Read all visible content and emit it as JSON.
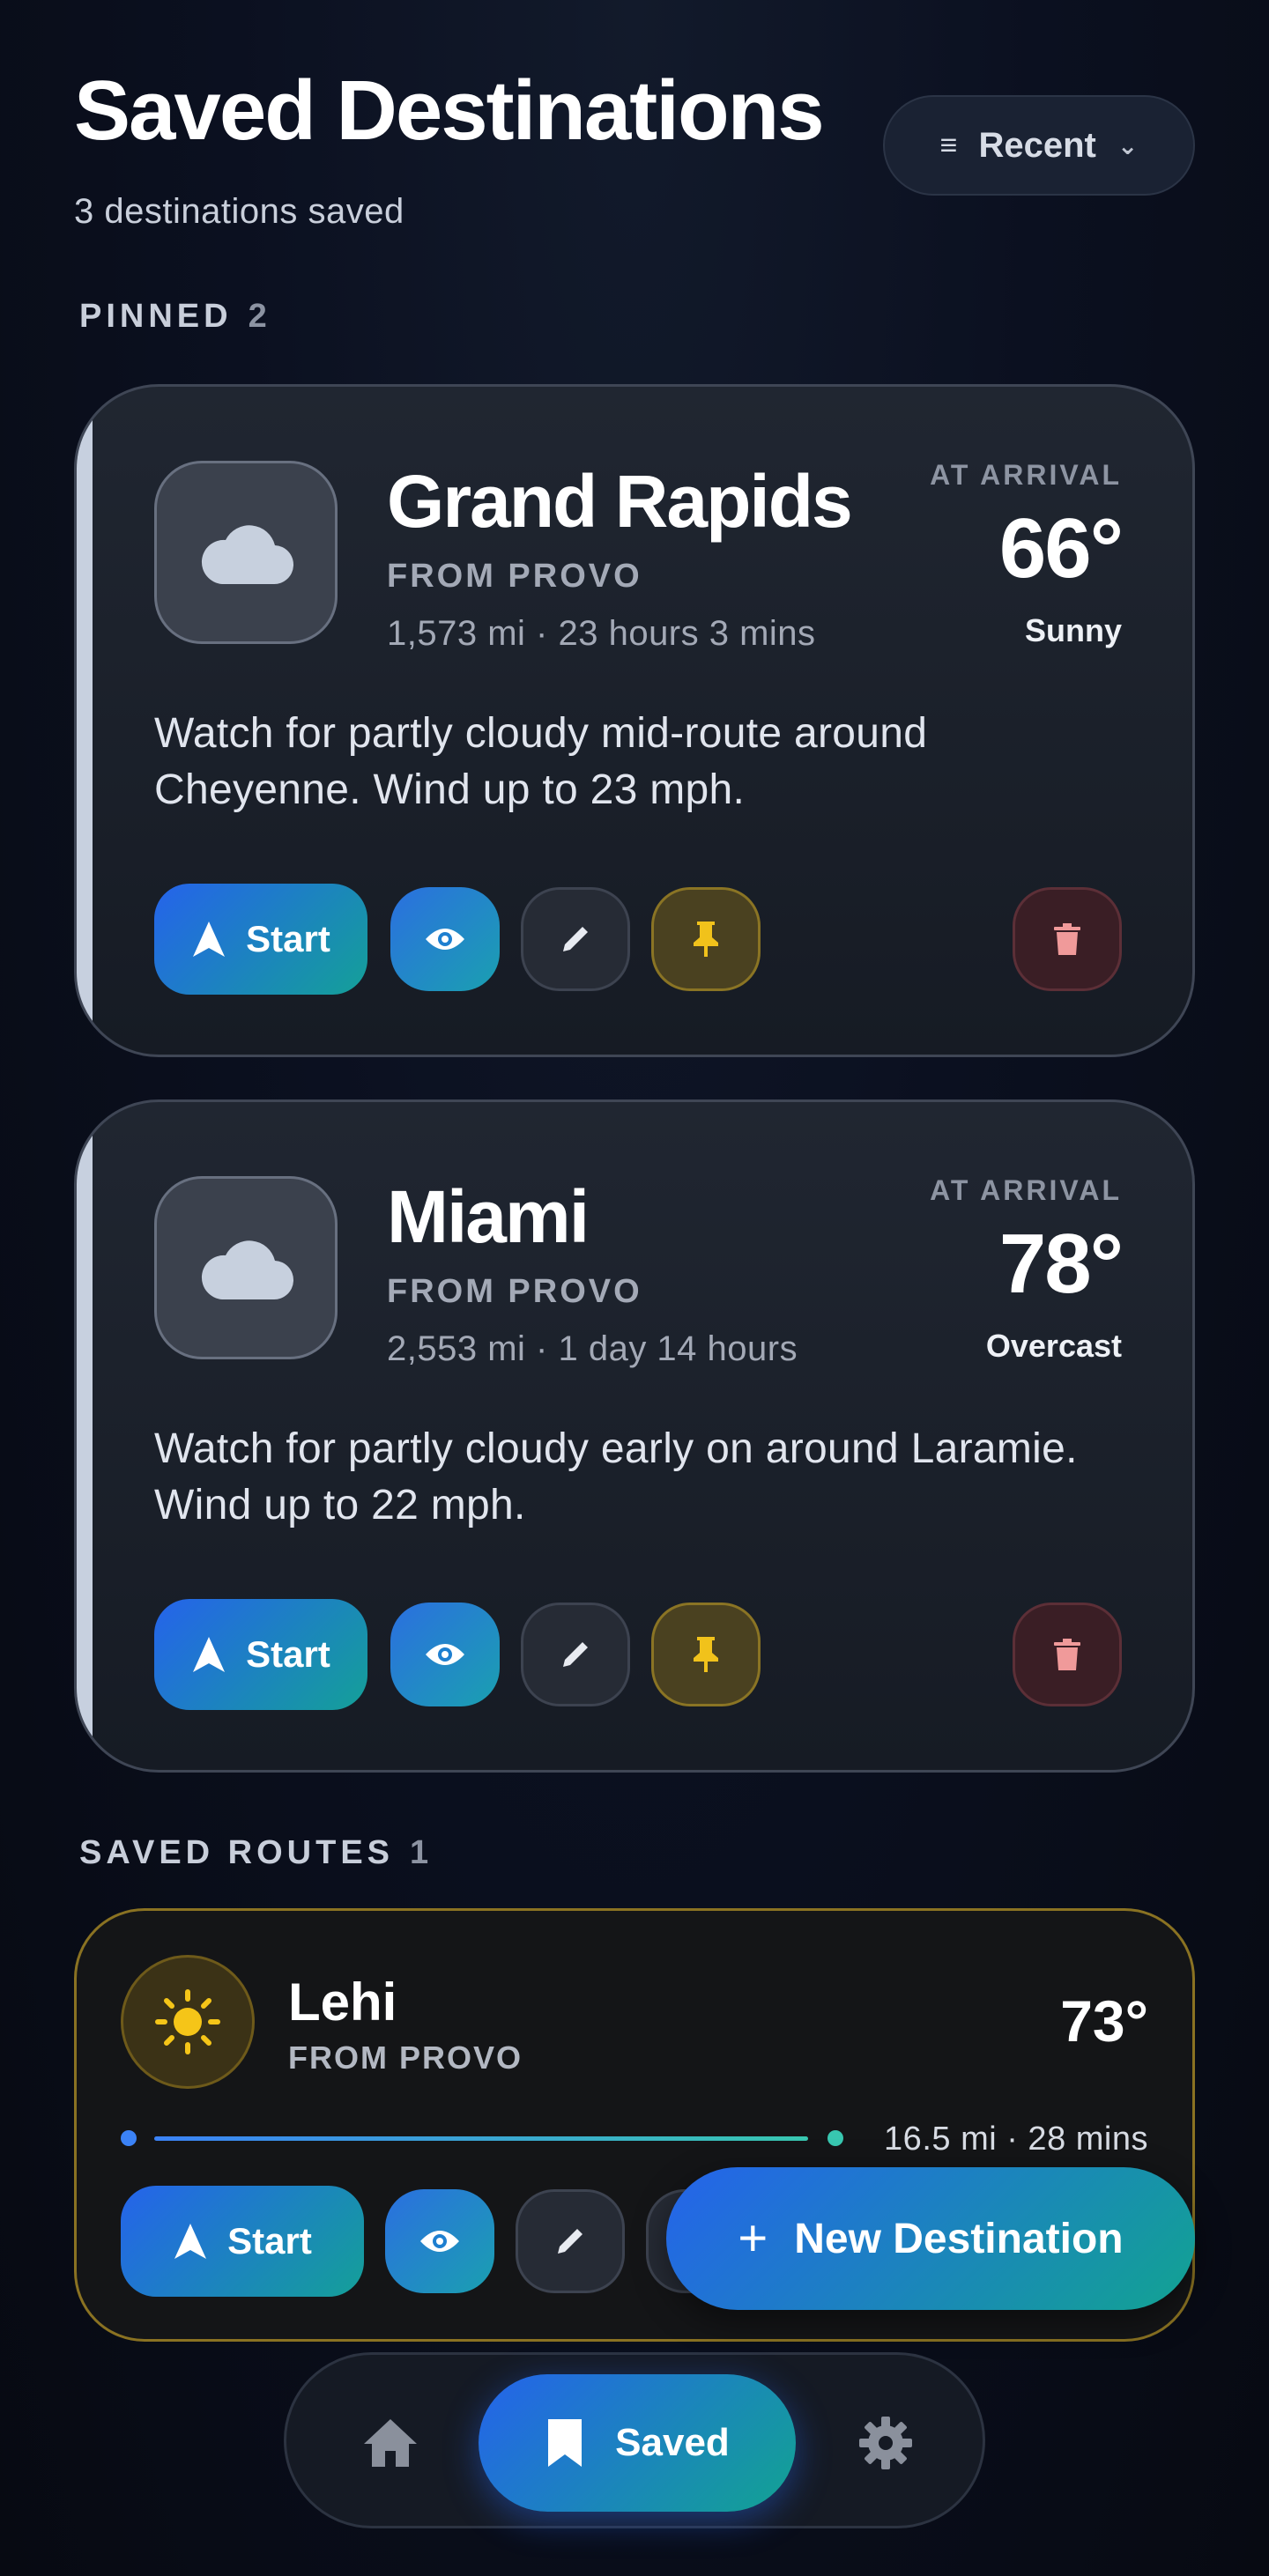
{
  "header": {
    "title": "Saved Destinations",
    "subtitle": "3 destinations saved",
    "sort_label": "Recent"
  },
  "sections": {
    "pinned": {
      "label": "PINNED",
      "count": "2"
    },
    "saved_routes": {
      "label": "SAVED ROUTES",
      "count": "1"
    }
  },
  "pinned_cards": [
    {
      "destination": "Grand Rapids",
      "from": "FROM PROVO",
      "distance": "1,573 mi · 23 hours 3 mins",
      "arrival_label": "AT ARRIVAL",
      "temperature": "66°",
      "condition": "Sunny",
      "note": "Watch for partly cloudy mid-route around Cheyenne. Wind up to 23 mph.",
      "start_label": "Start",
      "icon": "cloud-icon"
    },
    {
      "destination": "Miami",
      "from": "FROM PROVO",
      "distance": "2,553 mi · 1 day 14 hours",
      "arrival_label": "AT ARRIVAL",
      "temperature": "78°",
      "condition": "Overcast",
      "note": "Watch for partly cloudy early on around Laramie. Wind up to 22 mph.",
      "start_label": "Start",
      "icon": "cloud-icon"
    }
  ],
  "saved_routes": [
    {
      "destination": "Lehi",
      "from": "FROM PROVO",
      "temperature": "73°",
      "distance": "16.5 mi · 28 mins",
      "start_label": "Start",
      "icon": "sun-icon"
    }
  ],
  "fab": {
    "label": "New Destination"
  },
  "nav": {
    "saved_label": "Saved"
  },
  "colors": {
    "accent_blue": "#2563eb",
    "accent_teal": "#14a098",
    "pin_yellow": "#e8b923",
    "delete_red": "#f08a8a",
    "sun_yellow": "#f5c518"
  }
}
